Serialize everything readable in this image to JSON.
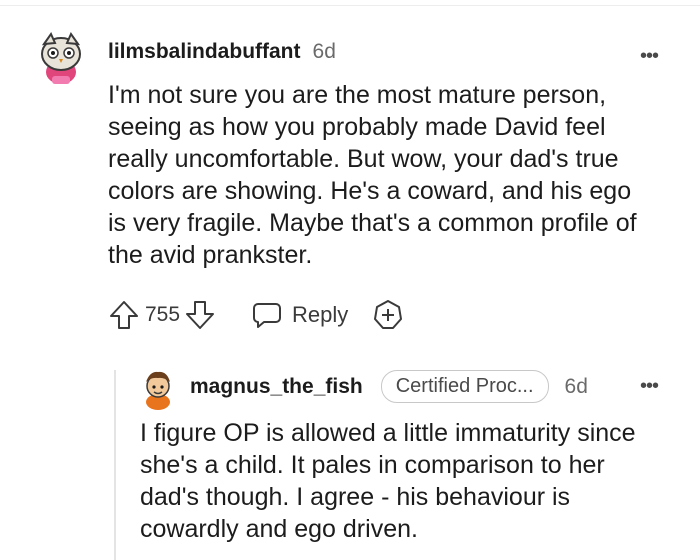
{
  "comments": [
    {
      "username": "lilmsbalindabuffant",
      "age": "6d",
      "body": "I'm not sure you are the most mature person, seeing as how you probably made David feel really uncomfortable. But wow, your dad's true colors are showing. He's a coward, and his ego is very fragile. Maybe that's a common profile of the avid prankster.",
      "score": "755",
      "reply_label": "Reply",
      "more_label": "•••"
    },
    {
      "username": "magnus_the_fish",
      "flair": "Certified Proc...",
      "age": "6d",
      "body": "I figure OP is allowed a little immaturity since she's a child. It pales in comparison to her dad's though. I agree - his behaviour is cowardly and ego driven.",
      "more_label": "•••"
    }
  ]
}
